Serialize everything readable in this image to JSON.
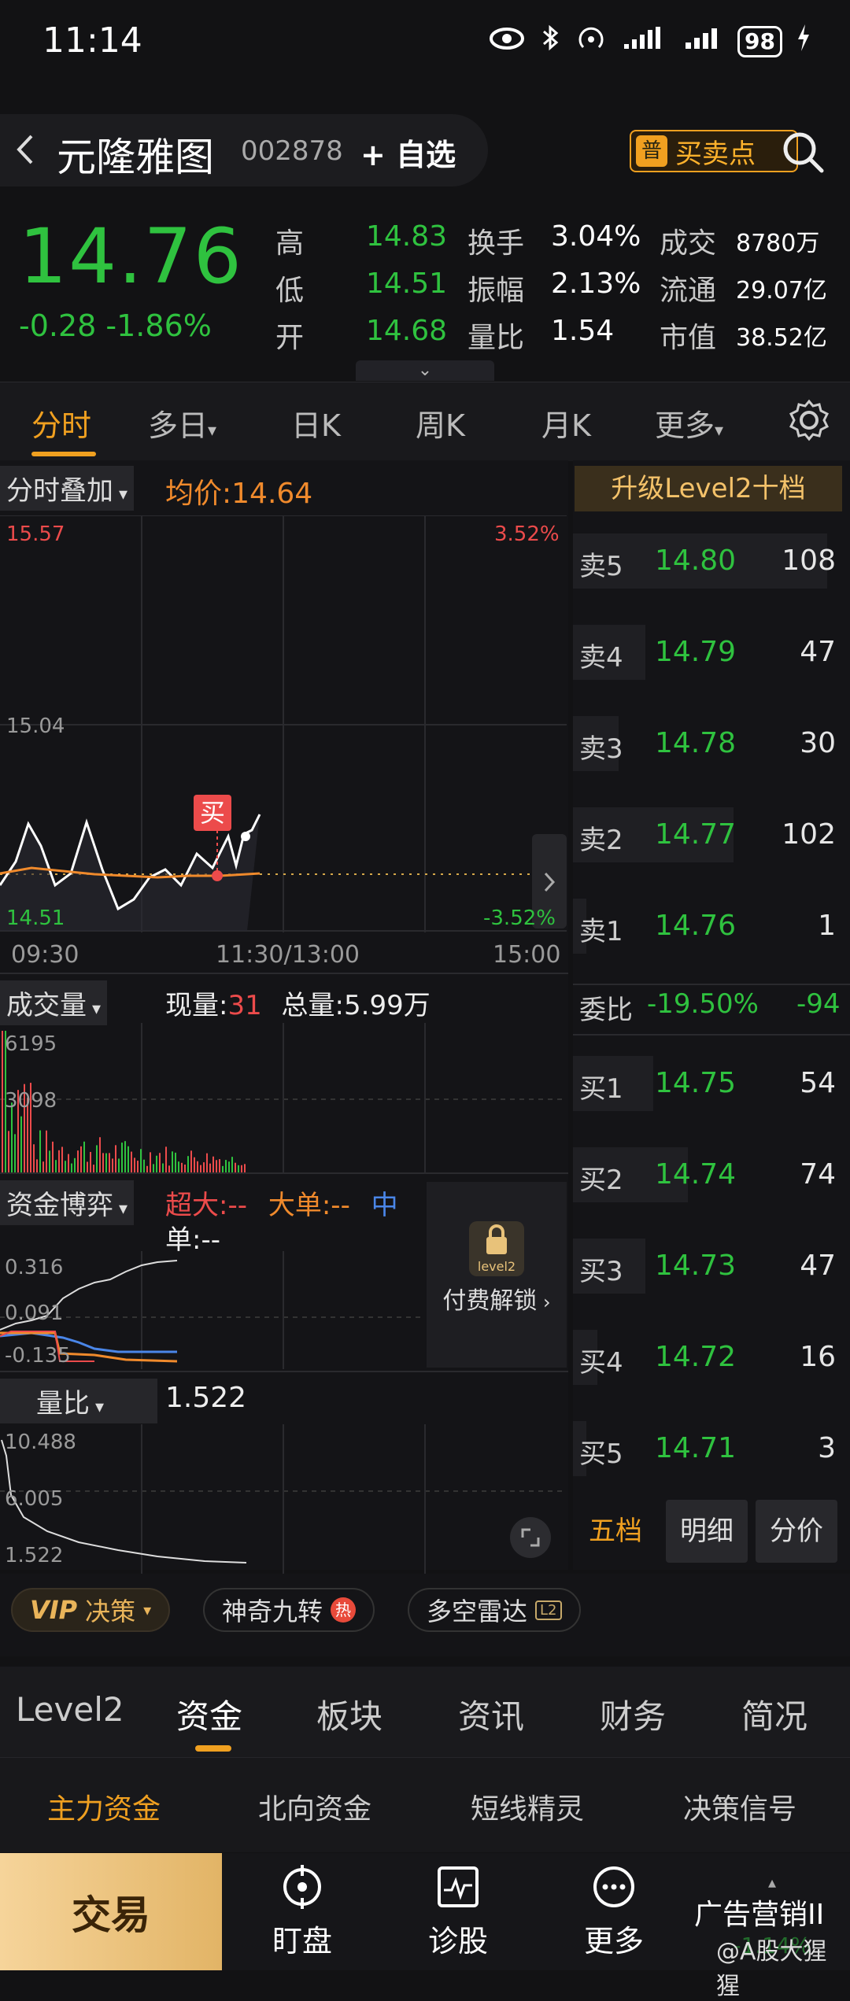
{
  "status_bar": {
    "time": "11:14",
    "signal": "4G",
    "battery": "98"
  },
  "header": {
    "name": "元隆雅图",
    "code": "002878",
    "add_watch": "+ 自选",
    "buy_sell_badge": "普",
    "buy_sell_label": "买卖点"
  },
  "quote": {
    "price": "14.76",
    "change": "-0.28",
    "change_pct": "-1.86%",
    "stats": [
      {
        "label": "高",
        "value": "14.83",
        "color": "#2fc23f"
      },
      {
        "label": "低",
        "value": "14.51",
        "color": "#2fc23f"
      },
      {
        "label": "开",
        "value": "14.68",
        "color": "#2fc23f"
      },
      {
        "label": "换手",
        "value": "3.04%",
        "color": "#ffffff"
      },
      {
        "label": "振幅",
        "value": "2.13%",
        "color": "#ffffff"
      },
      {
        "label": "量比",
        "value": "1.54",
        "color": "#ffffff"
      },
      {
        "label": "成交",
        "value": "8780万",
        "color": "#ffffff"
      },
      {
        "label": "流通",
        "value": "29.07亿",
        "color": "#ffffff"
      },
      {
        "label": "市值",
        "value": "38.52亿",
        "color": "#ffffff"
      }
    ],
    "expander_icon": "chevron-down-icon"
  },
  "tabs": [
    "分时",
    "多日",
    "日K",
    "周K",
    "月K",
    "更多"
  ],
  "intraday": {
    "overlay_label": "分时叠加",
    "avg_label": "均价:",
    "avg_value": "14.64",
    "y_top": "15.57",
    "y_mid": "15.04",
    "y_bottom": "14.51",
    "pct_top": "3.52%",
    "pct_bottom": "-3.52%",
    "time_start": "09:30",
    "time_mid": "11:30/13:00",
    "time_end": "15:00",
    "buy_marker": "买"
  },
  "volume": {
    "label": "成交量",
    "cur_label": "现量:",
    "cur_value": "31",
    "total_label": "总量:",
    "total_value": "5.99万",
    "y_top": "6195",
    "y_mid": "3098"
  },
  "fund": {
    "label": "资金博弈",
    "super_label": "超大:",
    "super_value": "--",
    "big_label": "大单:",
    "big_value": "--",
    "mid_label": "中",
    "mid_label2": "单:",
    "mid_value": "--",
    "y1": "0.316",
    "y2": "0.091",
    "y3": "-0.135",
    "lock_badge": "level2",
    "lock_label": "付费解锁"
  },
  "ratio": {
    "label": "量比",
    "value": "1.522",
    "y_top": "10.488",
    "y_mid": "6.005",
    "y_bottom": "1.522"
  },
  "orderbook": {
    "upgrade": "升级Level2十档",
    "asks": [
      {
        "label": "卖5",
        "price": "14.80",
        "vol": "108",
        "bar": 0.95
      },
      {
        "label": "卖4",
        "price": "14.79",
        "vol": "47",
        "bar": 0.27
      },
      {
        "label": "卖3",
        "price": "14.78",
        "vol": "30",
        "bar": 0.17
      },
      {
        "label": "卖2",
        "price": "14.77",
        "vol": "102",
        "bar": 0.6
      },
      {
        "label": "卖1",
        "price": "14.76",
        "vol": "1",
        "bar": 0.01
      }
    ],
    "ratio_label": "委比",
    "ratio_pct": "-19.50%",
    "ratio_num": "-94",
    "bids": [
      {
        "label": "买1",
        "price": "14.75",
        "vol": "54",
        "bar": 0.3
      },
      {
        "label": "买2",
        "price": "14.74",
        "vol": "74",
        "bar": 0.43
      },
      {
        "label": "买3",
        "price": "14.73",
        "vol": "47",
        "bar": 0.27
      },
      {
        "label": "买4",
        "price": "14.72",
        "vol": "16",
        "bar": 0.09
      },
      {
        "label": "买5",
        "price": "14.71",
        "vol": "3",
        "bar": 0.02
      }
    ],
    "tabs": [
      "五档",
      "明细",
      "分价"
    ]
  },
  "vip_row": {
    "vip": "VIP",
    "vip_label": "决策",
    "magic": "神奇九转",
    "hot": "热",
    "radar": "多空雷达",
    "radar_badge": "L2"
  },
  "section_tabs": [
    "Level2",
    "资金",
    "板块",
    "资讯",
    "财务",
    "简况"
  ],
  "sub_tabs": [
    "主力资金",
    "北向资金",
    "短线精灵",
    "决策信号"
  ],
  "nav": {
    "trade": "交易",
    "items": [
      "盯盘",
      "诊股",
      "更多"
    ],
    "ad": "广告营销II",
    "ad_value": "-1.14%",
    "watermark": "@A股大猩猩"
  }
}
